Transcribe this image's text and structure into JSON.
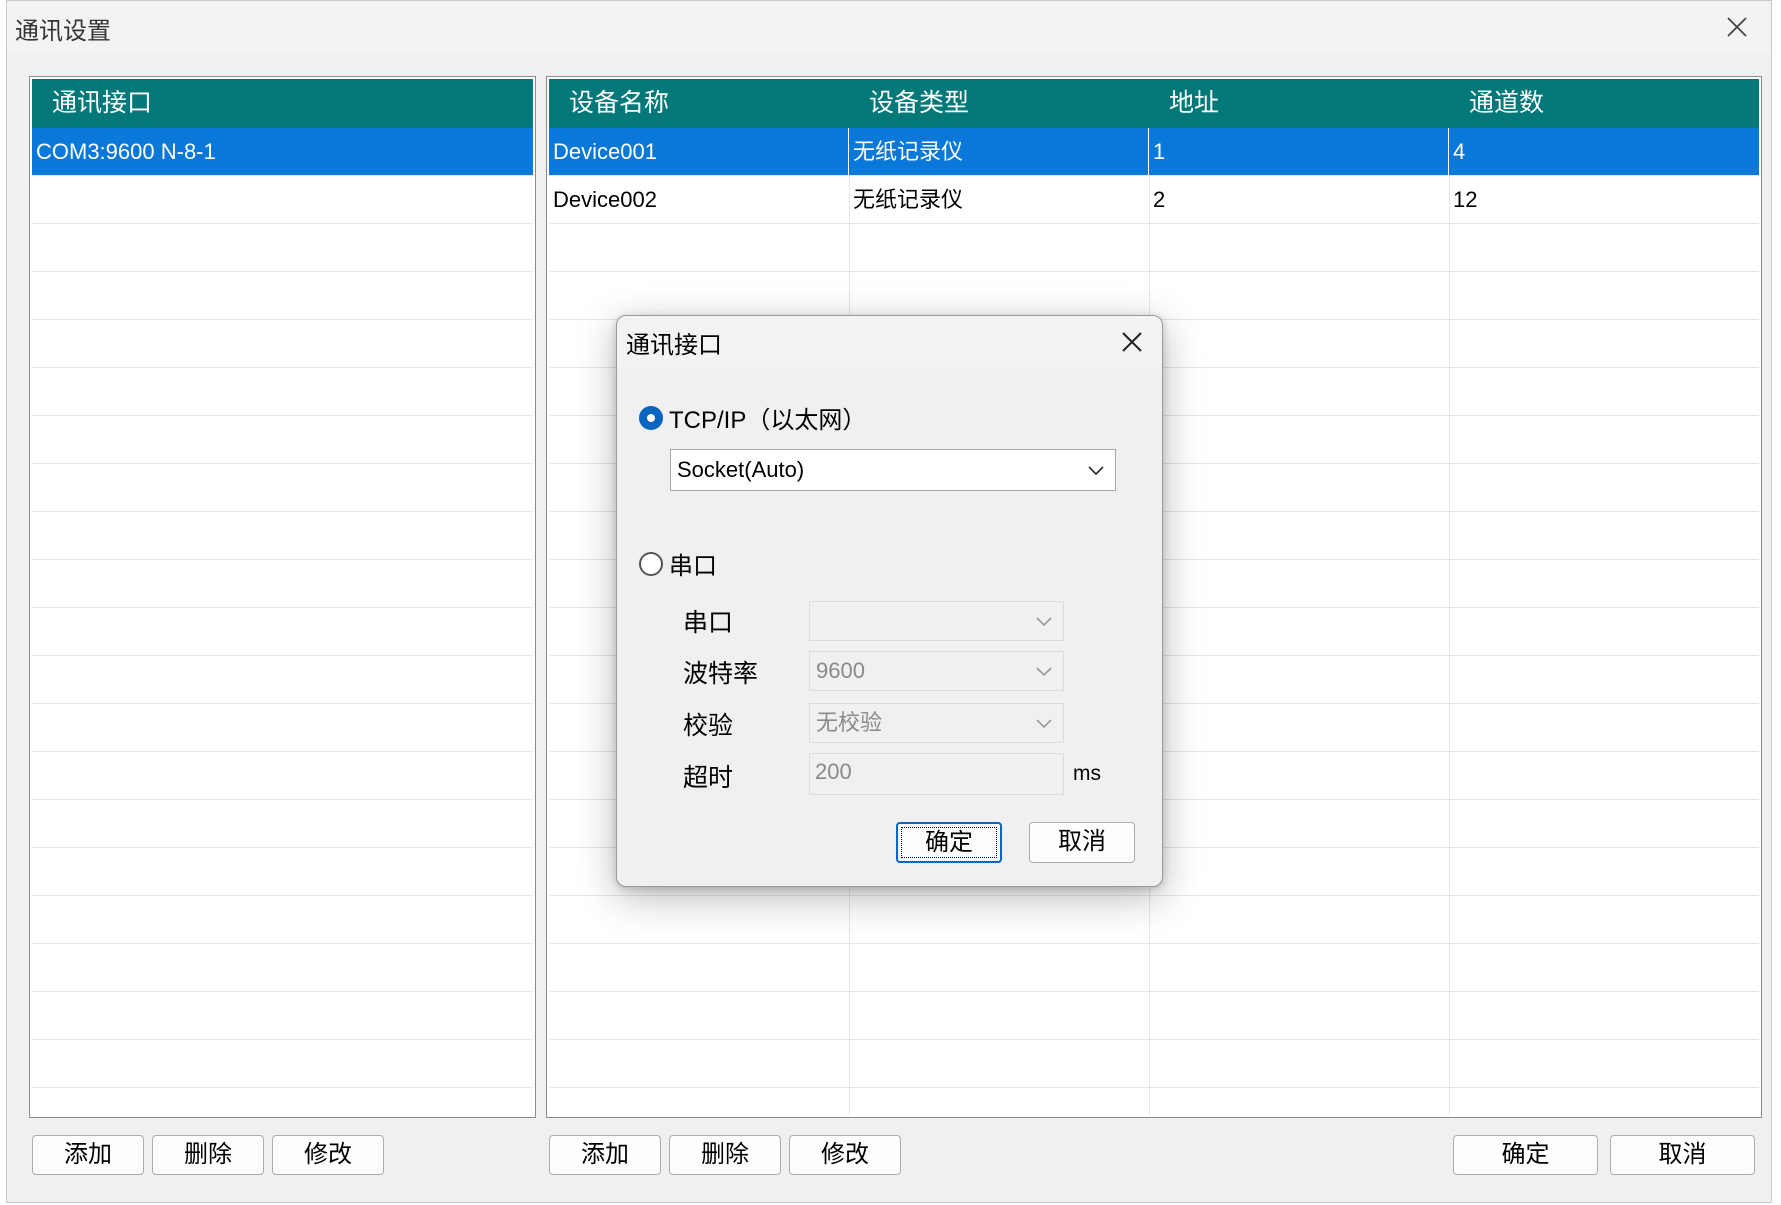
{
  "window": {
    "title": "通讯设置"
  },
  "interfaces": {
    "header": "通讯接口",
    "rows": [
      "COM3:9600 N-8-1"
    ],
    "buttons": {
      "add": "添加",
      "delete": "删除",
      "modify": "修改"
    }
  },
  "devices": {
    "columns": [
      "设备名称",
      "设备类型",
      "地址",
      "通道数"
    ],
    "rows": [
      [
        "Device001",
        "无纸记录仪",
        "1",
        "4"
      ],
      [
        "Device002",
        "无纸记录仪",
        "2",
        "12"
      ]
    ],
    "buttons": {
      "add": "添加",
      "delete": "删除",
      "modify": "修改"
    }
  },
  "footer": {
    "ok": "确定",
    "cancel": "取消"
  },
  "modal": {
    "title": "通讯接口",
    "tcp_label": "TCP/IP（以太网）",
    "tcp_selected": true,
    "socket_value": "Socket(Auto)",
    "serial_label": "串口",
    "serial_selected": false,
    "fields": {
      "port_label": "串口",
      "port_value": "",
      "baud_label": "波特率",
      "baud_value": "9600",
      "parity_label": "校验",
      "parity_value": "无校验",
      "timeout_label": "超时",
      "timeout_value": "200",
      "timeout_unit": "ms"
    },
    "ok": "确定",
    "cancel": "取消"
  },
  "colors": {
    "header_bg": "#027878",
    "selection": "#0a78d8",
    "radio_accent": "#0b64c0"
  }
}
